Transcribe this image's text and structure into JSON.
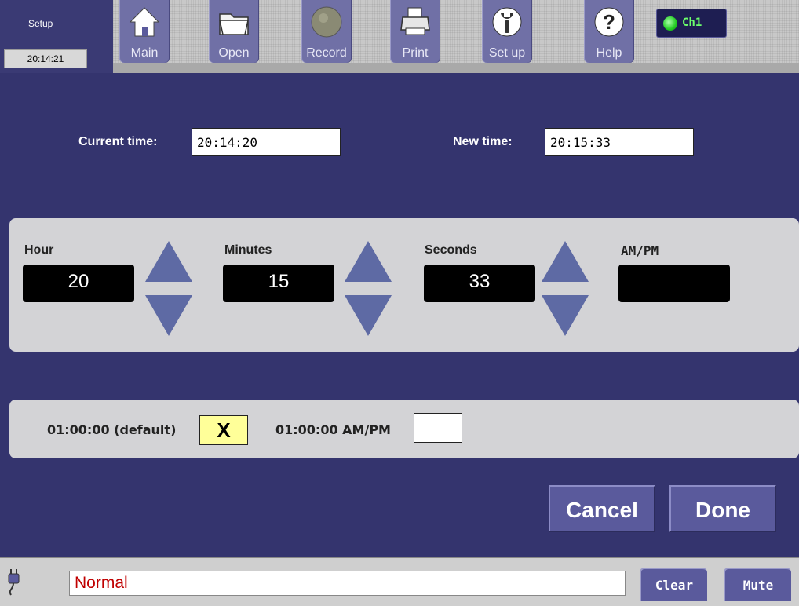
{
  "header": {
    "screen_label": "Setup",
    "clock": "20:14:21",
    "buttons": [
      {
        "label": "Main",
        "icon": "home-icon"
      },
      {
        "label": "Open",
        "icon": "folder-icon"
      },
      {
        "label": "Record",
        "icon": "record-icon"
      },
      {
        "label": "Print",
        "icon": "printer-icon"
      },
      {
        "label": "Set up",
        "icon": "wrench-icon"
      },
      {
        "label": "Help",
        "icon": "help-icon"
      }
    ],
    "channel": {
      "label": "Ch1",
      "status_color": "#22cc22"
    }
  },
  "time_row": {
    "current_label": "Current time:",
    "current_value": "20:14:20",
    "new_label": "New time:",
    "new_value": "20:15:33"
  },
  "adjust": {
    "hour": {
      "label": "Hour",
      "value": "20"
    },
    "minutes": {
      "label": "Minutes",
      "value": "15"
    },
    "seconds": {
      "label": "Seconds",
      "value": "33"
    },
    "ampm": {
      "label": "AM/PM",
      "value": ""
    }
  },
  "format": {
    "option_24h": {
      "label": "01:00:00 (default)",
      "mark": "X",
      "checked": true
    },
    "option_12h": {
      "label": "01:00:00 AM/PM",
      "mark": "",
      "checked": false
    }
  },
  "actions": {
    "cancel": "Cancel",
    "done": "Done"
  },
  "status_bar": {
    "message": "Normal",
    "clear": "Clear",
    "mute": "Mute"
  },
  "colors": {
    "accent": "#5a5a9c",
    "background": "#34346e",
    "checked_box": "#ffff99",
    "status_text": "#c00000"
  }
}
